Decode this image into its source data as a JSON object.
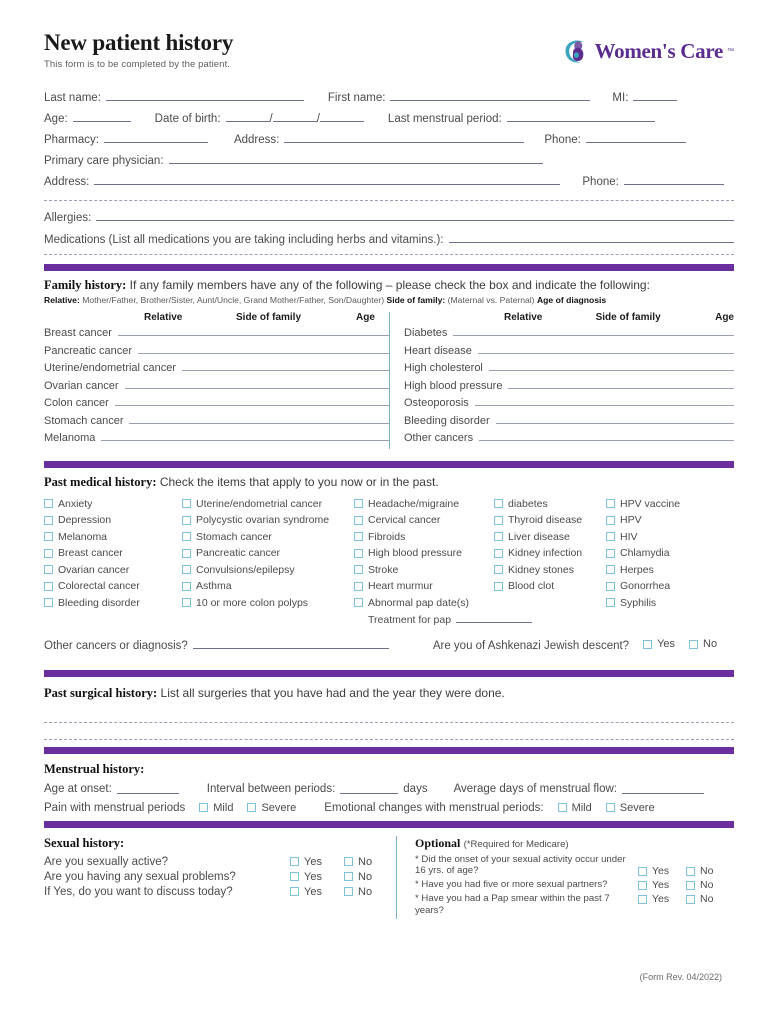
{
  "header": {
    "title": "New patient history",
    "subtitle": "This form is to be completed by the patient.",
    "logo_text": "Women's Care",
    "logo_tm": "™",
    "logo_icon": "mother-child-swirl-icon",
    "brand_purple": "#5b2d8e",
    "brand_teal": "#3aa5bd"
  },
  "patient": {
    "last_name_label": "Last name:",
    "first_name_label": "First name:",
    "mi_label": "MI:",
    "age_label": "Age:",
    "dob_label": "Date of birth:",
    "dob_sep": "/",
    "lmp_label": "Last menstrual period:",
    "pharmacy_label": "Pharmacy:",
    "address_label": "Address:",
    "phone_label": "Phone:",
    "pcp_label": "Primary care physician:",
    "address2_label": "Address:",
    "phone2_label": "Phone:",
    "last_name_value": "",
    "first_name_value": "",
    "mi_value": "",
    "age_value": "",
    "lmp_value": "",
    "pharmacy_value": "",
    "address_value": "",
    "phone_value": "",
    "pcp_value": "",
    "address2_value": "",
    "phone2_value": ""
  },
  "allergies": {
    "allergies_label": "Allergies:",
    "medications_label": "Medications (List all medications you are taking including herbs and vitamins.):",
    "allergies_value": "",
    "medications_value": ""
  },
  "family_history": {
    "heading": "Family history:",
    "instruction": "If any family members have any of the following – please check the box and indicate the following:",
    "legend_relative_label": "Relative:",
    "legend_relative_text": "Mother/Father, Brother/Sister, Aunt/Uncle, Grand Mother/Father, Son/Daughter)",
    "legend_side_label": "Side of family:",
    "legend_side_text": "(Maternal vs. Paternal)",
    "legend_age_label": "Age of diagnosis",
    "columns": [
      "Relative",
      "Side of family",
      "Age"
    ],
    "left_rows": [
      "Breast cancer",
      "Pancreatic cancer",
      "Uterine/endometrial cancer",
      "Ovarian cancer",
      "Colon cancer",
      "Stomach cancer",
      "Melanoma"
    ],
    "right_rows": [
      "Diabetes",
      "Heart disease",
      "High cholesterol",
      "High blood pressure",
      "Osteoporosis",
      "Bleeding disorder",
      "Other cancers"
    ]
  },
  "past_medical": {
    "heading": "Past medical history:",
    "instruction": "Check the items that apply to you now or in the past.",
    "col1": [
      "Anxiety",
      "Depression",
      "Melanoma",
      "Breast cancer",
      "Ovarian cancer",
      "Colorectal cancer",
      "Bleeding disorder"
    ],
    "col2": [
      "Uterine/endometrial cancer",
      "Polycystic ovarian syndrome",
      "Stomach cancer",
      "Pancreatic cancer",
      "Convulsions/epilepsy",
      "Asthma",
      "10 or more colon polyps"
    ],
    "col3": [
      "Headache/migraine",
      "Cervical cancer",
      "Fibroids",
      "High blood pressure",
      "Stroke",
      "Heart murmur",
      "Abnormal pap date(s)"
    ],
    "col4": [
      "diabetes",
      "Thyroid disease",
      "Liver disease",
      "Kidney infection",
      "Kidney stones",
      "Blood clot"
    ],
    "col5": [
      "HPV vaccine",
      "HPV",
      "HIV",
      "Chlamydia",
      "Herpes",
      "Gonorrhea",
      "Syphilis"
    ],
    "treatment_for_pap_label": "Treatment for pap",
    "treatment_for_pap_value": "",
    "other_cancers_label": "Other cancers or diagnosis?",
    "other_cancers_value": "",
    "ashkenazi_label": "Are you of Ashkenazi Jewish descent?",
    "yes_label": "Yes",
    "no_label": "No"
  },
  "past_surgical": {
    "heading": "Past surgical history:",
    "instruction": "List all surgeries that you have had and the year they were done.",
    "line1_value": "",
    "line2_value": ""
  },
  "menstrual": {
    "heading": "Menstrual history:",
    "age_onset_label": "Age at onset:",
    "age_onset_value": "",
    "interval_label": "Interval between periods:",
    "interval_value": "",
    "days_label": "days",
    "avg_flow_label": "Average days of menstrual flow:",
    "avg_flow_value": "",
    "pain_label": "Pain with menstrual periods",
    "emotional_label": "Emotional changes with menstrual periods:",
    "mild_label": "Mild",
    "severe_label": "Severe"
  },
  "sexual": {
    "heading": "Sexual history:",
    "questions": [
      "Are you sexually active?",
      "Are you having any sexual problems?",
      "If Yes, do you want to discuss today?"
    ],
    "yes_label": "Yes",
    "no_label": "No"
  },
  "optional": {
    "heading": "Optional",
    "heading_note": "(*Required for Medicare)",
    "questions": [
      "* Did the onset of your sexual activity occur under 16 yrs. of age?",
      "* Have you had five or more sexual partners?",
      "* Have you had a Pap smear within the past 7 years?"
    ],
    "yes_label": "Yes",
    "no_label": "No"
  },
  "footer": {
    "revision": "(Form Rev. 04/2022)"
  }
}
